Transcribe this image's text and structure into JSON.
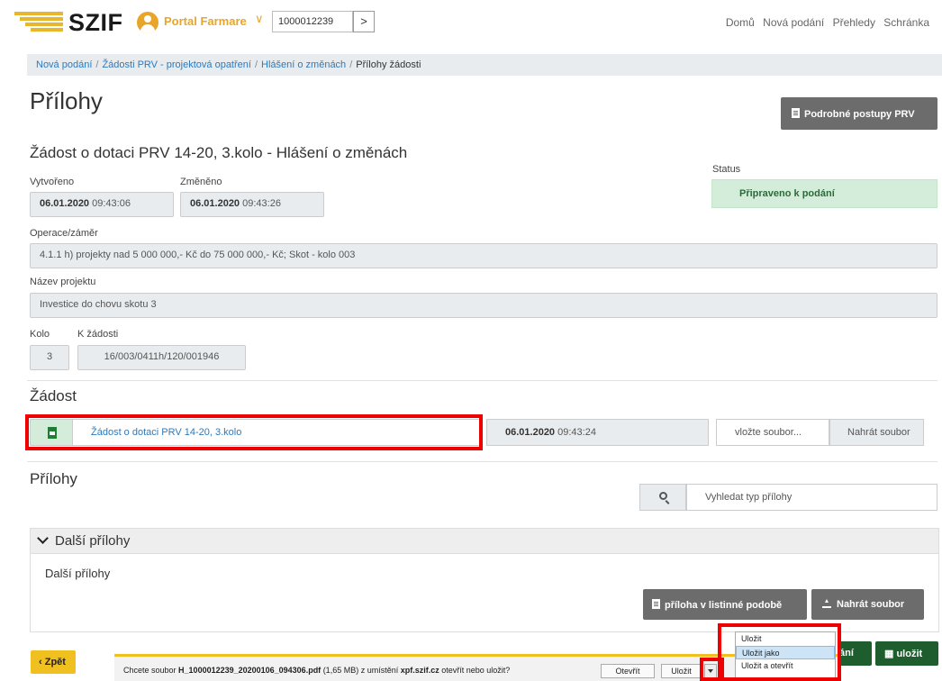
{
  "header": {
    "logo": "SZIF",
    "portal": "Portal Farmare",
    "account_id": "1000012239",
    "go_label": ">",
    "nav": [
      "Domů",
      "Nová podání",
      "Přehledy",
      "Schránka"
    ]
  },
  "breadcrumb": [
    "Nová podání",
    "Žádosti PRV - projektová opatření",
    "Hlášení o změnách",
    "Přílohy žádosti"
  ],
  "page": {
    "title": "Přílohy",
    "postupy_button": "Podrobné postupy PRV",
    "subtitle": "Žádost o dotaci PRV 14-20, 3.kolo - Hlášení o změnách"
  },
  "meta": {
    "created_label": "Vytvořeno",
    "created_date": "06.01.2020",
    "created_time": "09:43:06",
    "changed_label": "Změněno",
    "changed_date": "06.01.2020",
    "changed_time": "09:43:26",
    "status_label": "Status",
    "status_value": "Připraveno k podání",
    "operace_label": "Operace/záměr",
    "operace_value": "4.1.1 h) projekty nad 5 000 000,- Kč do 75 000 000,- Kč; Skot - kolo 003",
    "nazev_label": "Název projektu",
    "nazev_value": "Investice do chovu skotu 3",
    "kolo_label": "Kolo",
    "kolo_value": "3",
    "k_zadosti_label": "K žádosti",
    "k_zadosti_value": "16/003/0411h/120/001946"
  },
  "zadost": {
    "title": "Žádost",
    "file_link": "Žádost o dotaci PRV 14-20, 3.kolo",
    "file_date": "06.01.2020",
    "file_time": "09:43:24",
    "file_placeholder": "vložte soubor...",
    "upload_label": "Nahrát soubor"
  },
  "prilohy": {
    "title": "Přílohy",
    "search_placeholder": "Vyhledat typ přílohy",
    "accordion_title": "Další přílohy",
    "accordion_subtitle": "Další přílohy",
    "paper_button": "příloha v listinné podobě",
    "upload_button": "Nahrát soubor"
  },
  "footer": {
    "back": "Zpět",
    "submit_partial": "ání",
    "save": "uložit"
  },
  "download_bar": {
    "prefix": "Chcete soubor ",
    "filename": "H_1000012239_20200106_094306.pdf",
    "middle": " (1,65 MB) z umístění ",
    "host": "xpf.szif.cz",
    "suffix": " otevřít nebo uložit?",
    "open": "Otevřít",
    "save": "Uložit"
  },
  "save_menu": [
    "Uložit",
    "Uložit jako",
    "Uložit a otevřít"
  ],
  "colors": {
    "accent_yellow": "#f0c020",
    "link_blue": "#2a7abf",
    "status_green_bg": "#d4edda",
    "dark_green": "#1e5e2e",
    "highlight_red": "#e00000"
  }
}
